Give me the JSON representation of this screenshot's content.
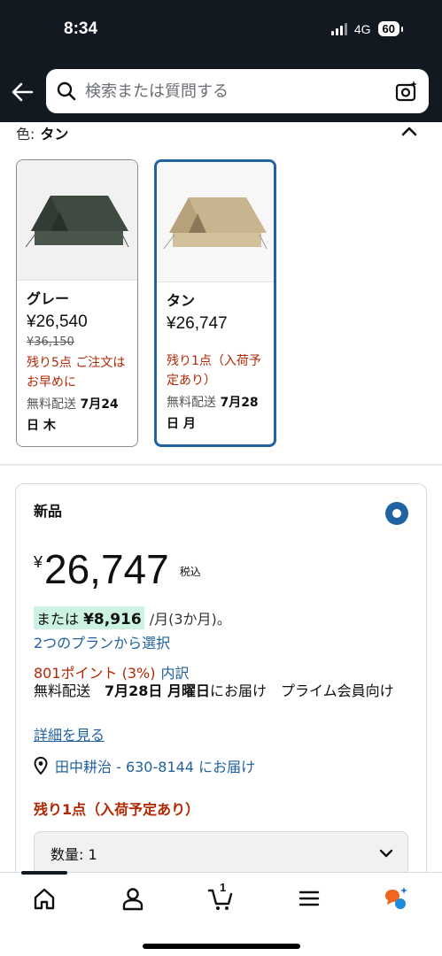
{
  "status_bar": {
    "time": "8:34",
    "network": "4G",
    "battery": "60"
  },
  "header": {
    "search_placeholder": "検索または質問する"
  },
  "color_selector": {
    "label": "色:",
    "selected": "タン",
    "variants": [
      {
        "name": "グレー",
        "price": "¥26,540",
        "original_price": "¥36,150",
        "stock_note": "残り5点 ご注文はお早めに",
        "shipping_prefix": "無料配送 ",
        "shipping_date": "7月24日 木",
        "selected": false,
        "tent_color": "#3f4a41"
      },
      {
        "name": "タン",
        "price": "¥26,747",
        "original_price": "",
        "stock_note": "残り1点（入荷予定あり）",
        "shipping_prefix": "無料配送 ",
        "shipping_date": "7月28日 月",
        "selected": true,
        "tent_color": "#c8b48f"
      }
    ]
  },
  "buy_box": {
    "condition": "新品",
    "currency": "¥",
    "price": "26,747",
    "tax_note": "税込",
    "installment_prefix": "または ",
    "installment_amount": "¥8,916",
    "installment_suffix": "/月(3か月)。",
    "plan_link": "2つのプランから選択",
    "points": "801ポイント (3%)",
    "points_breakdown": "内訳",
    "delivery_prefix": "無料配送　",
    "delivery_date": "7月28日 月曜日",
    "delivery_suffix": "にお届け　プライム会員向け",
    "details_link": "詳細を見る",
    "address": "田中耕治 - 630-8144 にお届け",
    "stock": "残り1点（入荷予定あり）",
    "quantity_label": "数量: 1"
  },
  "bottom_nav": {
    "cart_count": "1"
  },
  "colors": {
    "header_bg": "#131921",
    "link": "#2162a1",
    "price_red": "#b12704",
    "installment_highlight": "#ccf3e1"
  }
}
